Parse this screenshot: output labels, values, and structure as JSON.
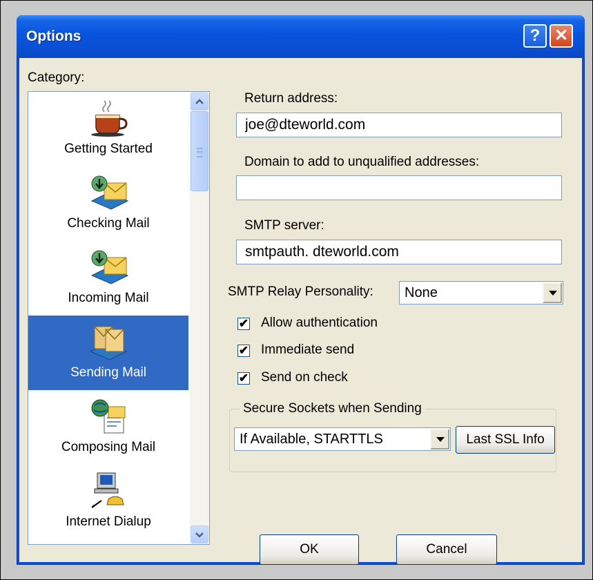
{
  "window": {
    "title": "Options",
    "help_button": "?",
    "close_button": "✕"
  },
  "category": {
    "label": "Category:",
    "items": [
      {
        "label": "Getting Started",
        "icon": "coffee-cup-icon",
        "selected": false
      },
      {
        "label": "Checking Mail",
        "icon": "checking-mail-icon",
        "selected": false
      },
      {
        "label": "Incoming Mail",
        "icon": "incoming-mail-icon",
        "selected": false
      },
      {
        "label": "Sending Mail",
        "icon": "sending-mail-icon",
        "selected": true
      },
      {
        "label": "Composing Mail",
        "icon": "composing-mail-icon",
        "selected": false
      },
      {
        "label": "Internet Dialup",
        "icon": "dialup-computer-icon",
        "selected": false
      }
    ]
  },
  "form": {
    "return_address_label": "Return address:",
    "return_address_value": "joe@dteworld.com",
    "domain_label": "Domain to add to unqualified addresses:",
    "domain_value": "",
    "smtp_server_label": "SMTP server:",
    "smtp_server_value": "smtpauth. dteworld.com",
    "relay_label": "SMTP Relay Personality:",
    "relay_value": "None",
    "allow_auth_label": "Allow authentication",
    "allow_auth_checked": true,
    "immediate_send_label": "Immediate send",
    "immediate_send_checked": true,
    "send_on_check_label": "Send on check",
    "send_on_check_checked": true,
    "ssl_group_title": "Secure Sockets when Sending",
    "ssl_value": "If Available, STARTTLS",
    "last_ssl_button": "Last SSL Info"
  },
  "buttons": {
    "ok": "OK",
    "cancel": "Cancel"
  },
  "colors": {
    "title_bar": "#0a50d8",
    "selection": "#316ac5",
    "dialog_bg": "#ece9d8"
  }
}
